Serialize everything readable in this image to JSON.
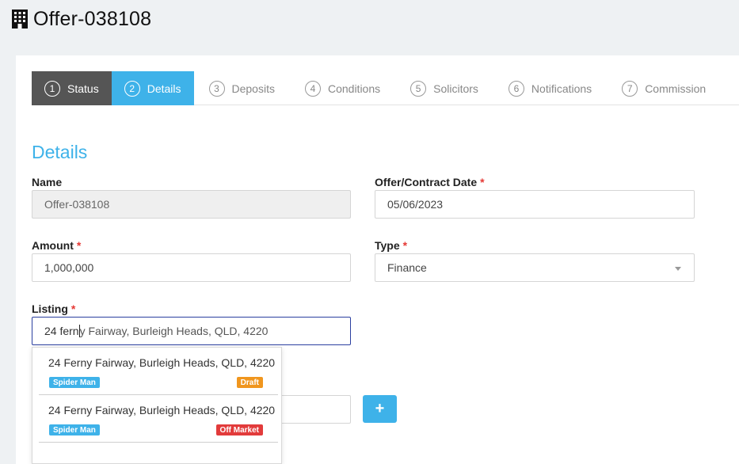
{
  "header": {
    "title": "Offer-038108",
    "icon": "building-icon"
  },
  "steps": [
    {
      "num": "1",
      "label": "Status",
      "state": "done"
    },
    {
      "num": "2",
      "label": "Details",
      "state": "active"
    },
    {
      "num": "3",
      "label": "Deposits",
      "state": "pending"
    },
    {
      "num": "4",
      "label": "Conditions",
      "state": "pending"
    },
    {
      "num": "5",
      "label": "Solicitors",
      "state": "pending"
    },
    {
      "num": "6",
      "label": "Notifications",
      "state": "pending"
    },
    {
      "num": "7",
      "label": "Commission",
      "state": "pending"
    }
  ],
  "details": {
    "title": "Details",
    "name_label": "Name",
    "name_value": "Offer-038108",
    "date_label": "Offer/Contract Date",
    "date_value": "05/06/2023",
    "amount_label": "Amount",
    "amount_value": "1,000,000",
    "type_label": "Type",
    "type_value": "Finance",
    "listing_label": "Listing",
    "listing_typed": "24 fern",
    "listing_completion": "y Fairway, Burleigh Heads, QLD, 4220",
    "required_mark": "*",
    "add_label": "+"
  },
  "suggestions": [
    {
      "address": "24 Ferny Fairway, Burleigh Heads, QLD, 4220",
      "agent": "Spider Man",
      "status": "Draft"
    },
    {
      "address": "24 Ferny Fairway, Burleigh Heads, QLD, 4220",
      "agent": "Spider Man",
      "status": "Off Market"
    }
  ],
  "colors": {
    "accent": "#3eb2e9",
    "done": "#555555",
    "required": "#e53935",
    "draft": "#f0961e",
    "off_market": "#e23b3b"
  }
}
